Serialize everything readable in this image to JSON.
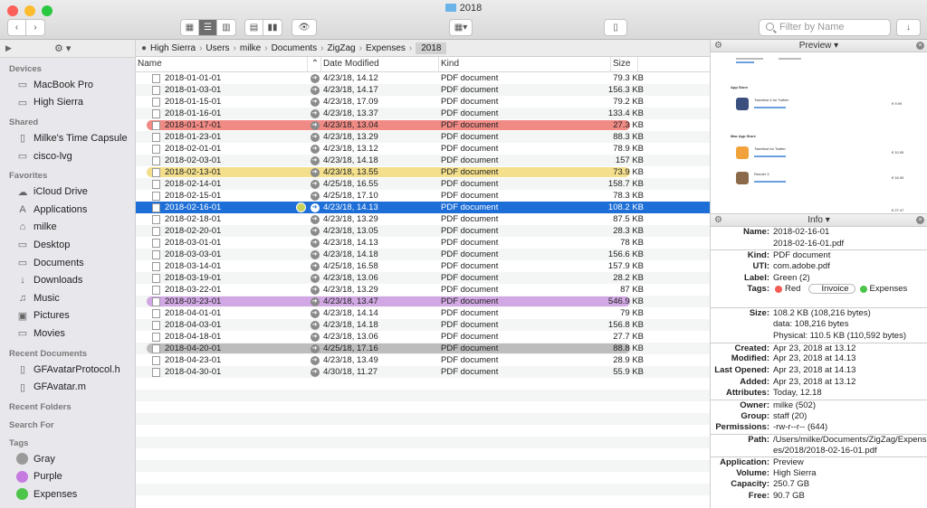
{
  "window": {
    "title": "2018"
  },
  "toolbar": {
    "back_icon": "chevron-left-icon",
    "forward_icon": "chevron-right-icon",
    "filter_placeholder": "Filter by Name"
  },
  "sidebar": {
    "sections": {
      "devices": "Devices",
      "shared": "Shared",
      "favorites": "Favorites",
      "recent_documents": "Recent Documents",
      "recent_folders": "Recent Folders",
      "search_for": "Search For",
      "tags": "Tags"
    },
    "devices": [
      "MacBook Pro",
      "High Sierra"
    ],
    "shared": [
      "Milke's Time Capsule",
      "cisco-lvg"
    ],
    "favorites": [
      "iCloud Drive",
      "Applications",
      "milke",
      "Desktop",
      "Documents",
      "Downloads",
      "Music",
      "Pictures",
      "Movies"
    ],
    "recent_documents": [
      "GFAvatarProtocol.h",
      "GFAvatar.m"
    ],
    "tags": [
      {
        "label": "Gray",
        "color": "#9a9a9a"
      },
      {
        "label": "Purple",
        "color": "#c57be0"
      },
      {
        "label": "Expenses",
        "color": "#4dc44a"
      }
    ]
  },
  "pathbar": [
    "High Sierra",
    "Users",
    "milke",
    "Documents",
    "ZigZag",
    "Expenses",
    "2018"
  ],
  "columns": {
    "name": "Name",
    "date": "Date Modified",
    "kind": "Kind",
    "size": "Size"
  },
  "files": [
    {
      "name": "2018-01-01-01",
      "date": "4/23/18, 14.12",
      "kind": "PDF document",
      "size": "79.3 KB"
    },
    {
      "name": "2018-01-03-01",
      "date": "4/23/18, 14.17",
      "kind": "PDF document",
      "size": "156.3 KB"
    },
    {
      "name": "2018-01-15-01",
      "date": "4/23/18, 17.09",
      "kind": "PDF document",
      "size": "79.2 KB"
    },
    {
      "name": "2018-01-16-01",
      "date": "4/23/18, 13.37",
      "kind": "PDF document",
      "size": "133.4 KB"
    },
    {
      "name": "2018-01-17-01",
      "date": "4/23/18, 13.04",
      "kind": "PDF document",
      "size": "27.3 KB",
      "tag": "#f08a85"
    },
    {
      "name": "2018-01-23-01",
      "date": "4/23/18, 13.29",
      "kind": "PDF document",
      "size": "88.3 KB"
    },
    {
      "name": "2018-02-01-01",
      "date": "4/23/18, 13.12",
      "kind": "PDF document",
      "size": "78.9 KB"
    },
    {
      "name": "2018-02-03-01",
      "date": "4/23/18, 14.18",
      "kind": "PDF document",
      "size": "157 KB"
    },
    {
      "name": "2018-02-13-01",
      "date": "4/23/18, 13.55",
      "kind": "PDF document",
      "size": "73.9 KB",
      "tag": "#f3df8c"
    },
    {
      "name": "2018-02-14-01",
      "date": "4/25/18, 16.55",
      "kind": "PDF document",
      "size": "158.7 KB"
    },
    {
      "name": "2018-02-15-01",
      "date": "4/25/18, 17.10",
      "kind": "PDF document",
      "size": "78.3 KB"
    },
    {
      "name": "2018-02-16-01",
      "date": "4/23/18, 14.13",
      "kind": "PDF document",
      "size": "108.2 KB",
      "selected": true
    },
    {
      "name": "2018-02-18-01",
      "date": "4/23/18, 13.29",
      "kind": "PDF document",
      "size": "87.5 KB"
    },
    {
      "name": "2018-02-20-01",
      "date": "4/23/18, 13.05",
      "kind": "PDF document",
      "size": "28.3 KB"
    },
    {
      "name": "2018-03-01-01",
      "date": "4/23/18, 14.13",
      "kind": "PDF document",
      "size": "78 KB"
    },
    {
      "name": "2018-03-03-01",
      "date": "4/23/18, 14.18",
      "kind": "PDF document",
      "size": "156.6 KB"
    },
    {
      "name": "2018-03-14-01",
      "date": "4/25/18, 16.58",
      "kind": "PDF document",
      "size": "157.9 KB"
    },
    {
      "name": "2018-03-19-01",
      "date": "4/23/18, 13.06",
      "kind": "PDF document",
      "size": "28.2 KB"
    },
    {
      "name": "2018-03-22-01",
      "date": "4/23/18, 13.29",
      "kind": "PDF document",
      "size": "87 KB"
    },
    {
      "name": "2018-03-23-01",
      "date": "4/23/18, 13.47",
      "kind": "PDF document",
      "size": "546.9 KB",
      "tag": "#d2a8e4"
    },
    {
      "name": "2018-04-01-01",
      "date": "4/23/18, 14.14",
      "kind": "PDF document",
      "size": "79 KB"
    },
    {
      "name": "2018-04-03-01",
      "date": "4/23/18, 14.18",
      "kind": "PDF document",
      "size": "156.8 KB"
    },
    {
      "name": "2018-04-18-01",
      "date": "4/23/18, 13.06",
      "kind": "PDF document",
      "size": "27.7 KB"
    },
    {
      "name": "2018-04-20-01",
      "date": "4/25/18, 17.16",
      "kind": "PDF document",
      "size": "88.8 KB",
      "tag": "#bdbdbd"
    },
    {
      "name": "2018-04-23-01",
      "date": "4/23/18, 13.49",
      "kind": "PDF document",
      "size": "28.9 KB"
    },
    {
      "name": "2018-04-30-01",
      "date": "4/30/18, 11.27",
      "kind": "PDF document",
      "size": "55.9 KB"
    }
  ],
  "preview": {
    "header": "Preview",
    "items": [
      "App Store",
      "Tweetbot 4 for Twitter",
      "Mac App Store",
      "Tweetbot for Twitter",
      "Reeder 3"
    ],
    "prices": [
      "€ 9.99",
      "€ 10.99",
      "€ 16.99",
      "€ 27.47"
    ]
  },
  "info": {
    "header": "Info",
    "name_label": "Name:",
    "name_value": "2018-02-16-01",
    "name_file": "2018-02-16-01.pdf",
    "kind_label": "Kind:",
    "kind_value": "PDF document",
    "uti_label": "UTI:",
    "uti_value": "com.adobe.pdf",
    "label_label": "Label:",
    "label_value": "Green (2)",
    "tags_label": "Tags:",
    "tags": [
      {
        "label": "Red",
        "color": "#f25c54"
      },
      {
        "label": "Invoice",
        "color": ""
      },
      {
        "label": "Expenses",
        "color": "#4dc44a"
      }
    ],
    "size_label": "Size:",
    "size_value": "108.2 KB (108,216 bytes)",
    "size_data": "data: 108,216 bytes",
    "size_physical": "Physical: 110.5 KB (110,592 bytes)",
    "created_label": "Created:",
    "created_value": "Apr 23, 2018 at 13.12",
    "modified_label": "Modified:",
    "modified_value": "Apr 23, 2018 at 14.13",
    "lastopened_label": "Last Opened:",
    "lastopened_value": "Apr 23, 2018 at 14.13",
    "added_label": "Added:",
    "added_value": "Apr 23, 2018 at 13.12",
    "attributes_label": "Attributes:",
    "attributes_value": "Today, 12.18",
    "owner_label": "Owner:",
    "owner_value": "milke (502)",
    "group_label": "Group:",
    "group_value": "staff (20)",
    "permissions_label": "Permissions:",
    "permissions_value": "-rw-r--r-- (644)",
    "path_label": "Path:",
    "path_value": "/Users/milke/Documents/ZigZag/Expenses/2018/2018-02-16-01.pdf",
    "application_label": "Application:",
    "application_value": "Preview",
    "volume_label": "Volume:",
    "volume_value": "High Sierra",
    "capacity_label": "Capacity:",
    "capacity_value": "250.7 GB",
    "free_label": "Free:",
    "free_value": "90.7 GB"
  }
}
